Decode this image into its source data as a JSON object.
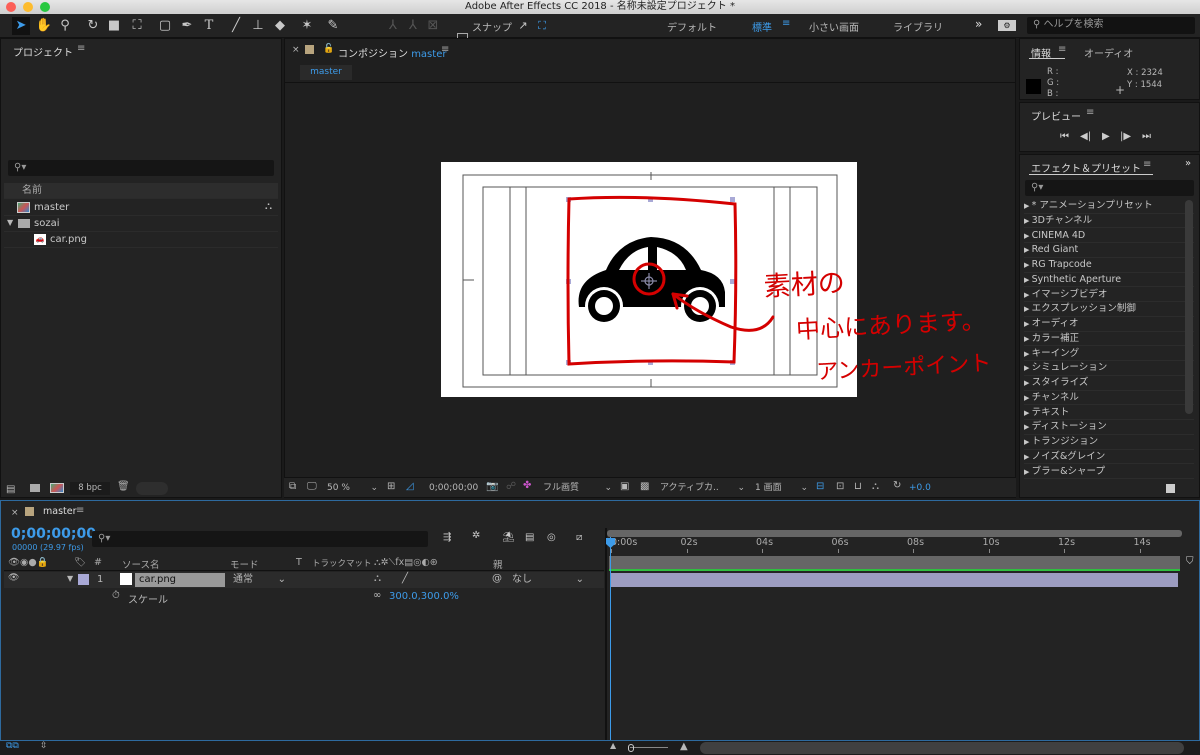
{
  "window": {
    "title": "Adobe After Effects CC 2018 - 名称未設定プロジェクト *"
  },
  "toolbar": {
    "snap_label": "スナップ",
    "workspaces": [
      "デフォルト",
      "標準",
      "小さい画面",
      "ライブラリ"
    ],
    "active_workspace": "標準",
    "more": "»",
    "help_placeholder": "ヘルプを検索"
  },
  "project": {
    "title": "プロジェクト",
    "column_name": "名前",
    "items": [
      {
        "name": "master",
        "type": "composition"
      },
      {
        "name": "sozai",
        "type": "folder"
      },
      {
        "name": "car.png",
        "type": "image"
      }
    ],
    "bpc": "8 bpc"
  },
  "composition": {
    "panel_label": "コンポジション",
    "comp_name": "master",
    "tab": "master",
    "zoom": "50 %",
    "timecode": "0;00;00;00",
    "quality": "フル画質",
    "camera": "アクティブカ..",
    "views": "1 画面",
    "exposure": "+0.0"
  },
  "annotation": {
    "lines": [
      "素材の",
      "中心にあります。",
      "アンカーポイント"
    ],
    "color": "#d40000"
  },
  "info": {
    "tab_info": "情報",
    "tab_audio": "オーディオ",
    "r": "R :",
    "g": "G :",
    "b": "B :",
    "x": "X : 2324",
    "y": "Y : 1544"
  },
  "preview": {
    "title": "プレビュー"
  },
  "effects": {
    "title": "エフェクト＆プリセット",
    "items": [
      "* アニメーションプリセット",
      "3Dチャンネル",
      "CINEMA 4D",
      "Red Giant",
      "RG Trapcode",
      "Synthetic Aperture",
      "イマーシブビデオ",
      "エクスプレッション制御",
      "オーディオ",
      "カラー補正",
      "キーイング",
      "シミュレーション",
      "スタイライズ",
      "チャンネル",
      "テキスト",
      "ディストーション",
      "トランジション",
      "ノイズ&グレイン",
      "ブラー&シャープ"
    ]
  },
  "timeline": {
    "tab": "master",
    "timecode": "0;00;00;00",
    "frames": "00000 (29.97 fps)",
    "columns": {
      "num": "#",
      "source": "ソース名",
      "mode": "モード",
      "t": "T",
      "trackmatte": "トラックマット",
      "parent": "親"
    },
    "layer": {
      "index": "1",
      "name": "car.png",
      "mode": "通常",
      "parent": "なし"
    },
    "property": {
      "name": "スケール",
      "value": "300.0,300.0%"
    },
    "ruler": [
      "0:00s",
      "02s",
      "04s",
      "06s",
      "08s",
      "10s",
      "12s",
      "14s"
    ]
  },
  "colors": {
    "accent": "#3d9be9",
    "layer_bar": "#9c9cc0",
    "label": "#a9a9d6",
    "work_area": "#2fbf3f"
  }
}
